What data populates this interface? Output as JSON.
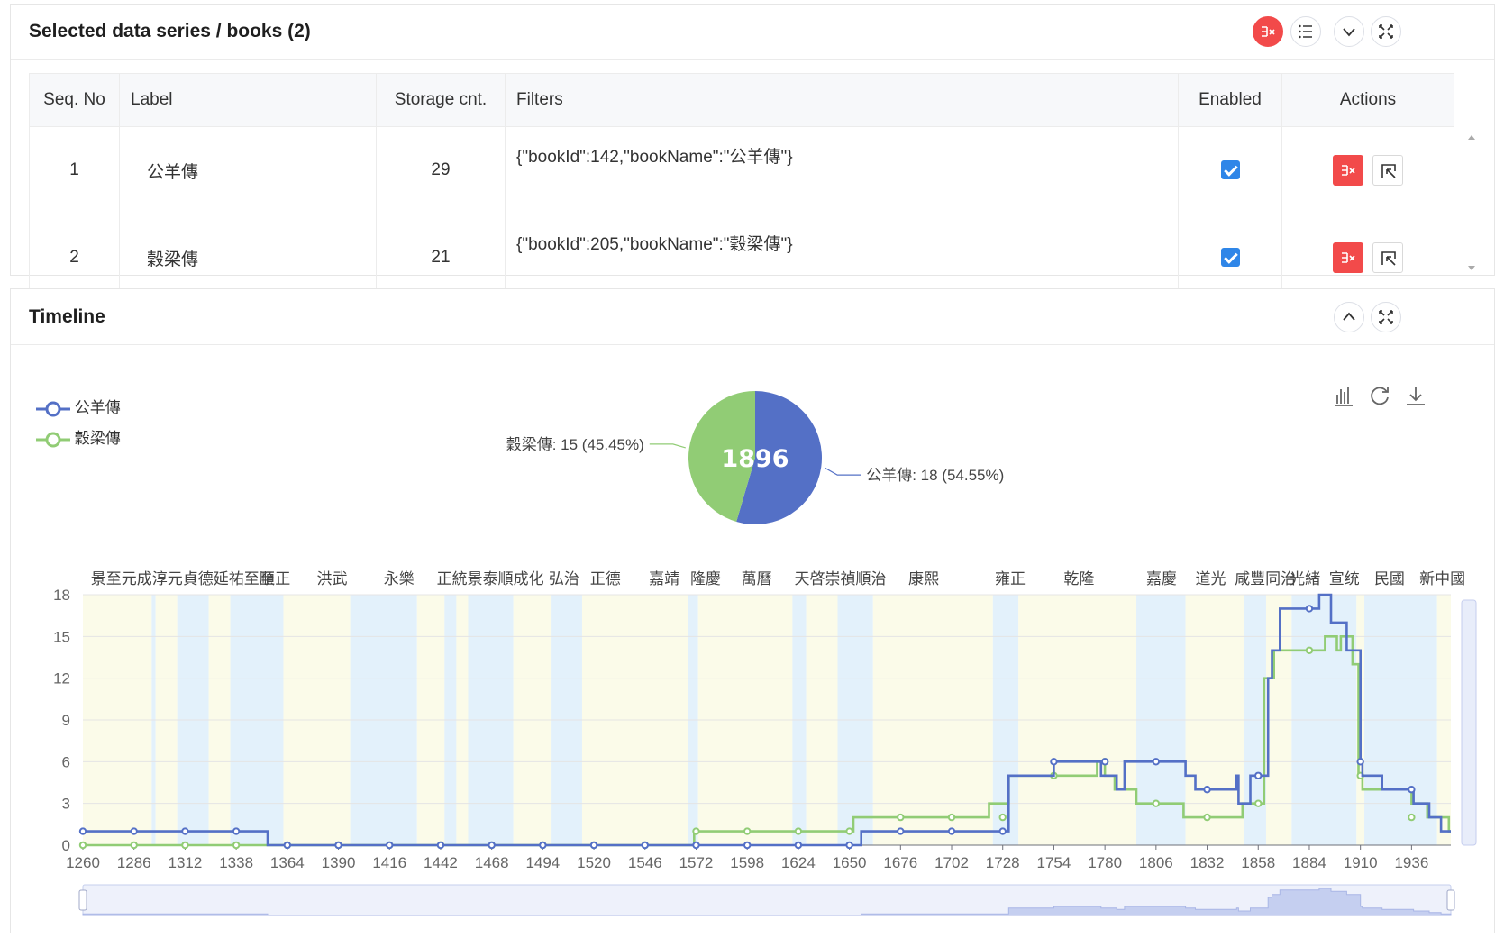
{
  "top_panel": {
    "title": "Selected data series / books (2)",
    "columns": [
      "Seq. No",
      "Label",
      "Storage cnt.",
      "Filters",
      "Enabled",
      "Actions"
    ],
    "rows": [
      {
        "seq": "1",
        "label": "公羊傳",
        "count": "29",
        "filters": "{\"bookId\":142,\"bookName\":\"公羊傳\"}",
        "enabled": true
      },
      {
        "seq": "2",
        "label": "穀梁傳",
        "count": "21",
        "filters": "{\"bookId\":205,\"bookName\":\"穀梁傳\"}",
        "enabled": true
      }
    ],
    "header_icons": [
      "remove-all-icon",
      "list-icon",
      "collapse-icon",
      "fullscreen-icon"
    ]
  },
  "timeline_panel": {
    "title": "Timeline",
    "header_icons": [
      "expand-up-icon",
      "fullscreen-icon"
    ],
    "toolbox_icons": [
      "bar-chart-icon",
      "refresh-icon",
      "download-icon"
    ],
    "colors": {
      "series1": "#5470c6",
      "series2": "#91cc75",
      "band_blue": "#e3f1fb",
      "band_yellow": "#fbfbe9"
    }
  },
  "chart_data": [
    {
      "type": "pie",
      "center_label": "1896",
      "slices": [
        {
          "name": "公羊傳",
          "value": 18,
          "label": "公羊傳: 18 (54.55%)"
        },
        {
          "name": "穀梁傳",
          "value": 15,
          "label": "穀梁傳: 15 (45.45%)"
        }
      ]
    },
    {
      "type": "line",
      "step": true,
      "legend": [
        "公羊傳",
        "穀梁傳"
      ],
      "legend_position": "top-left",
      "xlim": [
        1260,
        1956
      ],
      "ylim": [
        0,
        18
      ],
      "x_ticks": [
        1260,
        1286,
        1312,
        1338,
        1364,
        1390,
        1416,
        1442,
        1468,
        1494,
        1520,
        1546,
        1572,
        1598,
        1624,
        1650,
        1676,
        1702,
        1728,
        1754,
        1780,
        1806,
        1832,
        1858,
        1884,
        1910,
        1936
      ],
      "y_ticks": [
        0,
        3,
        6,
        9,
        12,
        15,
        18
      ],
      "grid": true,
      "series": [
        {
          "name": "公羊傳",
          "points": [
            [
              1260,
              1
            ],
            [
              1354,
              1
            ],
            [
              1354,
              0
            ],
            [
              1656,
              0
            ],
            [
              1656,
              1
            ],
            [
              1731,
              1
            ],
            [
              1731,
              5
            ],
            [
              1754,
              5
            ],
            [
              1754,
              6
            ],
            [
              1778,
              6
            ],
            [
              1778,
              5
            ],
            [
              1786,
              5
            ],
            [
              1786,
              4
            ],
            [
              1790,
              4
            ],
            [
              1790,
              6
            ],
            [
              1821,
              6
            ],
            [
              1821,
              5
            ],
            [
              1826,
              5
            ],
            [
              1826,
              4
            ],
            [
              1847,
              4
            ],
            [
              1847,
              5
            ],
            [
              1848,
              5
            ],
            [
              1848,
              3
            ],
            [
              1854,
              3
            ],
            [
              1854,
              5
            ],
            [
              1863,
              5
            ],
            [
              1863,
              12
            ],
            [
              1865,
              12
            ],
            [
              1865,
              14
            ],
            [
              1869,
              14
            ],
            [
              1869,
              17
            ],
            [
              1889,
              17
            ],
            [
              1889,
              18
            ],
            [
              1895,
              18
            ],
            [
              1895,
              16
            ],
            [
              1903,
              16
            ],
            [
              1903,
              14
            ],
            [
              1910,
              14
            ],
            [
              1910,
              6
            ],
            [
              1911,
              6
            ],
            [
              1911,
              5
            ],
            [
              1921,
              5
            ],
            [
              1921,
              4
            ],
            [
              1937,
              4
            ],
            [
              1937,
              3
            ],
            [
              1945,
              3
            ],
            [
              1945,
              2
            ],
            [
              1951,
              2
            ],
            [
              1951,
              1
            ],
            [
              1956,
              1
            ]
          ],
          "markers": [
            [
              1260,
              1
            ],
            [
              1286,
              1
            ],
            [
              1312,
              1
            ],
            [
              1338,
              1
            ],
            [
              1364,
              0
            ],
            [
              1390,
              0
            ],
            [
              1416,
              0
            ],
            [
              1442,
              0
            ],
            [
              1468,
              0
            ],
            [
              1494,
              0
            ],
            [
              1520,
              0
            ],
            [
              1546,
              0
            ],
            [
              1572,
              0
            ],
            [
              1598,
              0
            ],
            [
              1624,
              0
            ],
            [
              1650,
              0
            ],
            [
              1676,
              1
            ],
            [
              1702,
              1
            ],
            [
              1728,
              1
            ],
            [
              1754,
              6
            ],
            [
              1780,
              6
            ],
            [
              1806,
              6
            ],
            [
              1832,
              4
            ],
            [
              1858,
              5
            ],
            [
              1884,
              17
            ],
            [
              1910,
              6
            ],
            [
              1936,
              4
            ]
          ]
        },
        {
          "name": "穀梁傳",
          "points": [
            [
              1260,
              0
            ],
            [
              1571,
              0
            ],
            [
              1571,
              1
            ],
            [
              1652,
              1
            ],
            [
              1652,
              2
            ],
            [
              1721,
              2
            ],
            [
              1721,
              3
            ],
            [
              1731,
              3
            ],
            [
              1731,
              5
            ],
            [
              1776,
              5
            ],
            [
              1776,
              6
            ],
            [
              1780,
              6
            ],
            [
              1780,
              5
            ],
            [
              1785,
              5
            ],
            [
              1785,
              4
            ],
            [
              1796,
              4
            ],
            [
              1796,
              3
            ],
            [
              1820,
              3
            ],
            [
              1820,
              2
            ],
            [
              1850,
              2
            ],
            [
              1850,
              3
            ],
            [
              1861,
              3
            ],
            [
              1861,
              12
            ],
            [
              1866,
              12
            ],
            [
              1866,
              14
            ],
            [
              1884,
              14
            ],
            [
              1884,
              14
            ],
            [
              1892,
              14
            ],
            [
              1892,
              15
            ],
            [
              1898,
              15
            ],
            [
              1898,
              14
            ],
            [
              1900,
              14
            ],
            [
              1900,
              15
            ],
            [
              1906,
              15
            ],
            [
              1906,
              13
            ],
            [
              1909,
              13
            ],
            [
              1909,
              5
            ],
            [
              1911,
              5
            ],
            [
              1911,
              4
            ],
            [
              1936,
              4
            ],
            [
              1936,
              3
            ],
            [
              1944,
              3
            ],
            [
              1944,
              2
            ],
            [
              1955,
              2
            ],
            [
              1955,
              1
            ],
            [
              1956,
              1
            ]
          ],
          "markers": [
            [
              1260,
              0
            ],
            [
              1286,
              0
            ],
            [
              1312,
              0
            ],
            [
              1338,
              0
            ],
            [
              1364,
              0
            ],
            [
              1390,
              0
            ],
            [
              1416,
              0
            ],
            [
              1442,
              0
            ],
            [
              1468,
              0
            ],
            [
              1494,
              0
            ],
            [
              1520,
              0
            ],
            [
              1546,
              0
            ],
            [
              1572,
              1
            ],
            [
              1598,
              1
            ],
            [
              1624,
              1
            ],
            [
              1650,
              1
            ],
            [
              1676,
              2
            ],
            [
              1702,
              2
            ],
            [
              1728,
              2
            ],
            [
              1754,
              5
            ],
            [
              1780,
              6
            ],
            [
              1806,
              3
            ],
            [
              1832,
              2
            ],
            [
              1858,
              3
            ],
            [
              1884,
              14
            ],
            [
              1910,
              5
            ],
            [
              1936,
              2
            ]
          ]
        }
      ],
      "era_labels": [
        {
          "text": "景至元成淳元貞德延祐至順",
          "x": 1264
        },
        {
          "text": "至正",
          "x": 1350
        },
        {
          "text": "洪武",
          "x": 1379
        },
        {
          "text": "永樂",
          "x": 1413
        },
        {
          "text": "正統景泰順成化",
          "x": 1440
        },
        {
          "text": "弘治",
          "x": 1497
        },
        {
          "text": "正德",
          "x": 1518
        },
        {
          "text": "嘉靖",
          "x": 1548
        },
        {
          "text": "隆慶",
          "x": 1569
        },
        {
          "text": "萬曆",
          "x": 1595
        },
        {
          "text": "天啓崇禎順治",
          "x": 1622
        },
        {
          "text": "康熙",
          "x": 1680
        },
        {
          "text": "雍正",
          "x": 1724
        },
        {
          "text": "乾隆",
          "x": 1759
        },
        {
          "text": "嘉慶",
          "x": 1801
        },
        {
          "text": "道光",
          "x": 1826
        },
        {
          "text": "咸豐同治",
          "x": 1846
        },
        {
          "text": "光緒",
          "x": 1874
        },
        {
          "text": "宣统",
          "x": 1894
        },
        {
          "text": "民國",
          "x": 1917
        },
        {
          "text": "新中國",
          "x": 1940
        }
      ],
      "era_bands": [
        {
          "from": 1260,
          "to": 1295,
          "color": "yellow"
        },
        {
          "from": 1295,
          "to": 1297,
          "color": "blue"
        },
        {
          "from": 1297,
          "to": 1308,
          "color": "yellow"
        },
        {
          "from": 1308,
          "to": 1324,
          "color": "blue"
        },
        {
          "from": 1324,
          "to": 1335,
          "color": "yellow"
        },
        {
          "from": 1335,
          "to": 1362,
          "color": "blue"
        },
        {
          "from": 1362,
          "to": 1396,
          "color": "yellow"
        },
        {
          "from": 1396,
          "to": 1430,
          "color": "blue"
        },
        {
          "from": 1430,
          "to": 1444,
          "color": "yellow"
        },
        {
          "from": 1444,
          "to": 1450,
          "color": "blue"
        },
        {
          "from": 1450,
          "to": 1456,
          "color": "yellow"
        },
        {
          "from": 1456,
          "to": 1479,
          "color": "blue"
        },
        {
          "from": 1479,
          "to": 1498,
          "color": "yellow"
        },
        {
          "from": 1498,
          "to": 1514,
          "color": "blue"
        },
        {
          "from": 1514,
          "to": 1568,
          "color": "yellow"
        },
        {
          "from": 1568,
          "to": 1573,
          "color": "blue"
        },
        {
          "from": 1573,
          "to": 1621,
          "color": "yellow"
        },
        {
          "from": 1621,
          "to": 1628,
          "color": "blue"
        },
        {
          "from": 1628,
          "to": 1644,
          "color": "yellow"
        },
        {
          "from": 1644,
          "to": 1662,
          "color": "blue"
        },
        {
          "from": 1662,
          "to": 1723,
          "color": "yellow"
        },
        {
          "from": 1723,
          "to": 1736,
          "color": "blue"
        },
        {
          "from": 1736,
          "to": 1796,
          "color": "yellow"
        },
        {
          "from": 1796,
          "to": 1821,
          "color": "blue"
        },
        {
          "from": 1821,
          "to": 1851,
          "color": "yellow"
        },
        {
          "from": 1851,
          "to": 1862,
          "color": "blue"
        },
        {
          "from": 1862,
          "to": 1875,
          "color": "yellow"
        },
        {
          "from": 1875,
          "to": 1908,
          "color": "blue"
        },
        {
          "from": 1908,
          "to": 1912,
          "color": "yellow"
        },
        {
          "from": 1912,
          "to": 1949,
          "color": "blue"
        },
        {
          "from": 1949,
          "to": 1956,
          "color": "yellow"
        }
      ]
    }
  ]
}
